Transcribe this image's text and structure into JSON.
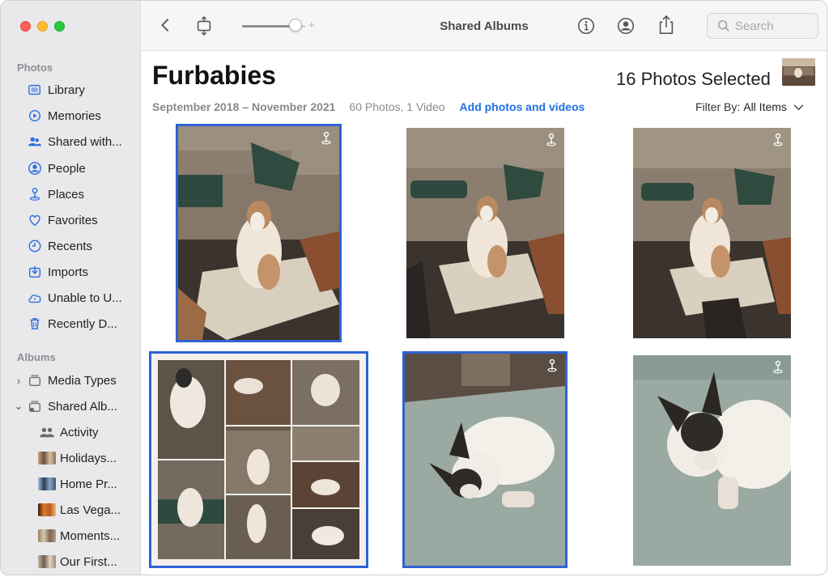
{
  "window": {
    "traffic_lights": [
      "#fe5f57",
      "#febc2e",
      "#28c840"
    ]
  },
  "sidebar": {
    "photos_header": "Photos",
    "items": [
      {
        "label": "Library",
        "icon": "library-icon"
      },
      {
        "label": "Memories",
        "icon": "memories-icon"
      },
      {
        "label": "Shared with...",
        "icon": "shared-with-you-icon"
      },
      {
        "label": "People",
        "icon": "people-icon"
      },
      {
        "label": "Places",
        "icon": "places-pin-icon"
      },
      {
        "label": "Favorites",
        "icon": "heart-icon"
      },
      {
        "label": "Recents",
        "icon": "clock-icon"
      },
      {
        "label": "Imports",
        "icon": "import-icon"
      },
      {
        "label": "Unable to U...",
        "icon": "cloud-alert-icon"
      },
      {
        "label": "Recently D...",
        "icon": "trash-icon"
      }
    ],
    "albums_header": "Albums",
    "albums": [
      {
        "label": "Media Types",
        "icon": "media-types-icon",
        "chevron": "›"
      },
      {
        "label": "Shared Alb...",
        "icon": "shared-albums-icon",
        "chevron": "⌄"
      }
    ],
    "shared_albums": [
      {
        "label": "Activity",
        "kind": "icon",
        "icon": "activity-icon"
      },
      {
        "label": "Holidays...",
        "kind": "thumb",
        "color": "#8a6f55"
      },
      {
        "label": "Home Pr...",
        "kind": "thumb",
        "color": "#3e4f70"
      },
      {
        "label": "Las Vega...",
        "kind": "thumb",
        "color": "#b65a2a"
      },
      {
        "label": "Moments...",
        "kind": "thumb",
        "color": "#7b6652"
      },
      {
        "label": "Our First...",
        "kind": "thumb",
        "color": "#6e5b4b"
      }
    ]
  },
  "toolbar": {
    "title": "Shared Albums",
    "zoom_plus": "+",
    "zoom_level": 0.85,
    "search_placeholder": "Search"
  },
  "album": {
    "title": "Furbabies",
    "selected_count": "16 Photos Selected",
    "date_range": "September 2018 – November 2021",
    "item_count": "60 Photos, 1 Video",
    "add_link": "Add photos and videos",
    "filter_label": "Filter By:",
    "filter_value": "All Items"
  },
  "photos": [
    {
      "name": "dog-on-rug-1",
      "selected": true,
      "shared": true
    },
    {
      "name": "dog-on-rug-2",
      "selected": false,
      "shared": true
    },
    {
      "name": "dog-on-rug-3",
      "selected": false,
      "shared": true
    },
    {
      "name": "dog-collage",
      "selected": true,
      "shared": false
    },
    {
      "name": "dog-on-bed-1",
      "selected": true,
      "shared": true
    },
    {
      "name": "dog-on-bed-2",
      "selected": false,
      "shared": true
    }
  ],
  "colors": {
    "accent": "#1f6fe5",
    "selection": "#2f62d4",
    "sidebar_icon": "#2d6fe0"
  }
}
